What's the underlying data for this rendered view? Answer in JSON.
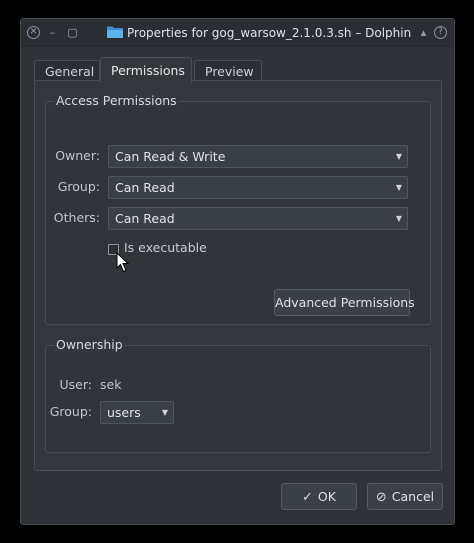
{
  "window": {
    "title": "Properties for gog_warsow_2.1.0.3.sh – Dolphin",
    "title_icon": "folder-icon",
    "controls": {
      "close": "✕",
      "minimize": "–",
      "maximize": "▢",
      "menu": "▴",
      "help": "?"
    }
  },
  "tabs": [
    {
      "label": "General"
    },
    {
      "label": "Permissions"
    },
    {
      "label": "Preview"
    }
  ],
  "access_permissions": {
    "title": "Access Permissions",
    "owner_label": "Owner:",
    "owner_value": "Can Read & Write",
    "group_label": "Group:",
    "group_value": "Can Read",
    "others_label": "Others:",
    "others_value": "Can Read",
    "executable_label": "Is executable",
    "executable_checked": false,
    "advanced_button": "Advanced Permissions"
  },
  "ownership": {
    "title": "Ownership",
    "user_label": "User:",
    "user_value": "sek",
    "group_label": "Group:",
    "group_value": "users"
  },
  "footer": {
    "ok_label": "OK",
    "ok_icon": "checkmark-icon",
    "cancel_label": "Cancel",
    "cancel_icon": "cancel-icon"
  },
  "colors": {
    "window_bg": "#2f3338",
    "panel_bg": "#33373c",
    "accent_folder": "#4a9fd8"
  }
}
